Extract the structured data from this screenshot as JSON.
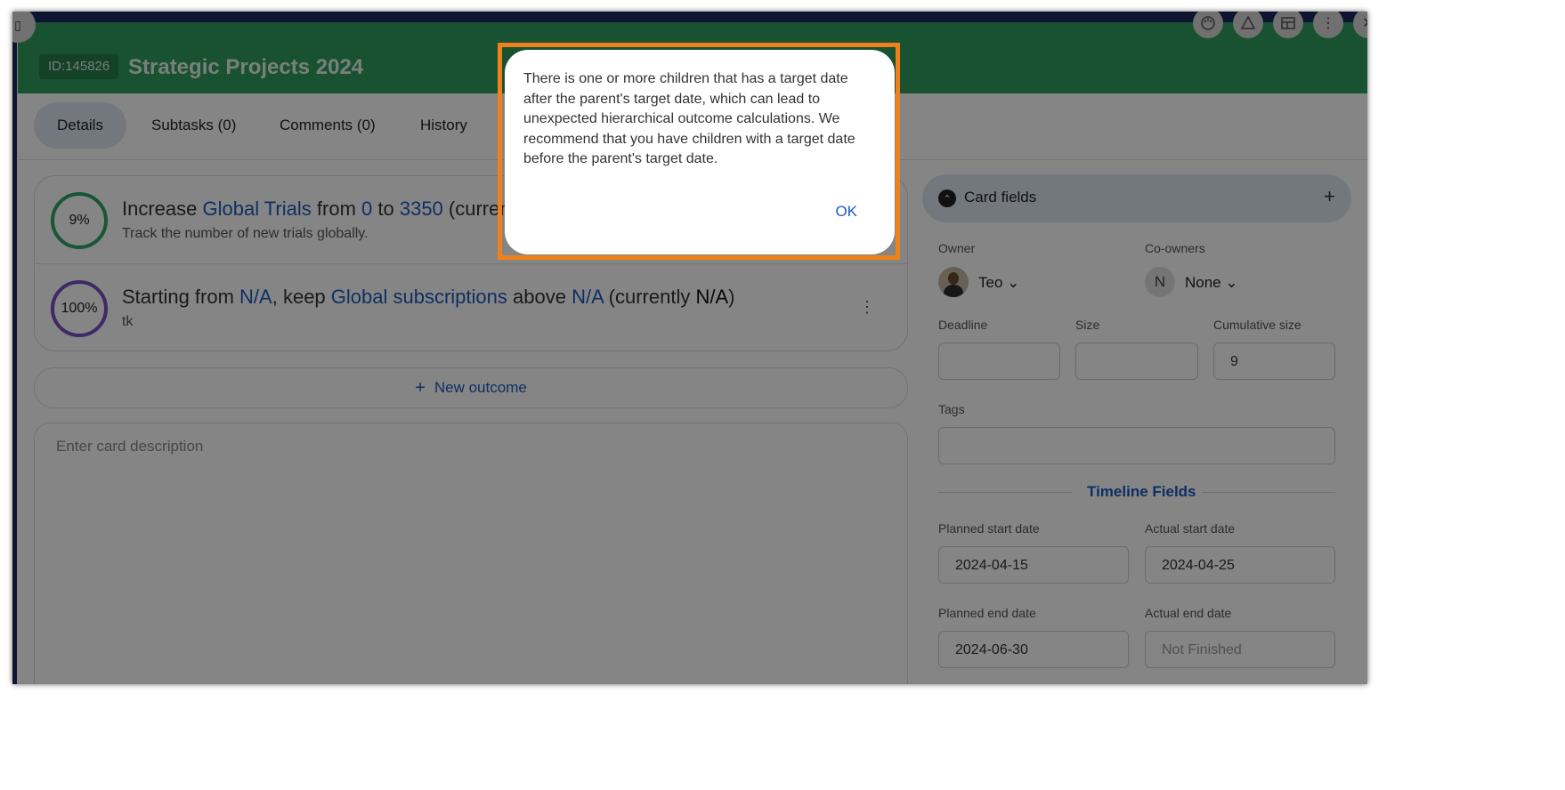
{
  "header": {
    "id_badge": "ID:145826",
    "title": "Strategic Projects 2024"
  },
  "toolbar": {
    "palette_icon": "palette-icon",
    "warning_icon": "warning-triangle-icon",
    "layout_icon": "layout-icon",
    "more_icon": "kebab-icon",
    "close_icon": "close-icon"
  },
  "tabs": [
    {
      "label": "Details",
      "active": true
    },
    {
      "label": "Subtasks (0)",
      "active": false
    },
    {
      "label": "Comments (0)",
      "active": false
    },
    {
      "label": "History",
      "active": false
    }
  ],
  "outcomes": [
    {
      "progress": "9%",
      "prefix": "Increase ",
      "metric": "Global Trials",
      "from_word": " from ",
      "from": "0",
      "to_word": " to ",
      "to": "3350",
      "suffix": " (current",
      "description": "Track the number of new trials globally."
    },
    {
      "progress": "100%",
      "prefix": "Starting from ",
      "start": "N/A",
      "mid": ", keep ",
      "metric": "Global subscriptions",
      "above_word": " above ",
      "above": "N/A",
      "currently_open": " (currently ",
      "currently": "N/A",
      "close": ")",
      "description": "tk"
    }
  ],
  "new_outcome": {
    "label": "New outcome"
  },
  "description": {
    "placeholder": "Enter card description"
  },
  "card_fields": {
    "label": "Card fields",
    "owner_label": "Owner",
    "owner_name": "Teo",
    "coowners_label": "Co-owners",
    "coowner_initial": "N",
    "coowner_name": "None",
    "deadline_label": "Deadline",
    "deadline_value": "",
    "size_label": "Size",
    "size_value": "",
    "cumulative_label": "Cumulative size",
    "cumulative_value": "9",
    "tags_label": "Tags",
    "tags_value": ""
  },
  "timeline": {
    "title": "Timeline Fields",
    "planned_start_label": "Planned start date",
    "planned_start": "2024-04-15",
    "actual_start_label": "Actual start date",
    "actual_start": "2024-04-25",
    "planned_end_label": "Planned end date",
    "planned_end": "2024-06-30",
    "actual_end_label": "Actual end date",
    "actual_end_placeholder": "Not Finished"
  },
  "dialog": {
    "message": "There is one or more children that has a target date after the parent's target date, which can lead to unexpected hierarchical outcome calculations. We recommend that you have children with a target date before the parent's target date.",
    "ok_label": "OK"
  }
}
